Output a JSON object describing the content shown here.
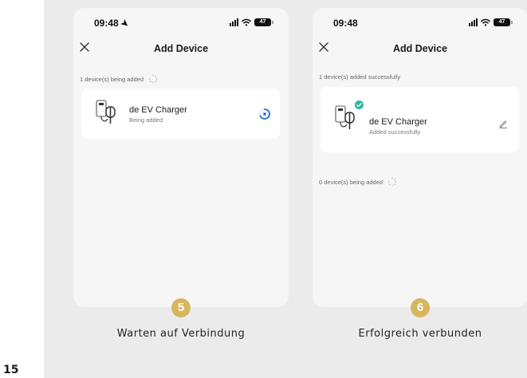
{
  "page_number": "15",
  "steps": [
    {
      "number": "5",
      "caption": "Warten auf Verbindung",
      "status_bar": {
        "time": "09:48",
        "location_arrow": "➤",
        "battery": "47"
      },
      "nav_title": "Add Device",
      "adding_label": "1 device(s) being added",
      "device": {
        "name": "de EV Charger",
        "status": "Being added"
      }
    },
    {
      "number": "6",
      "caption": "Erfolgreich verbunden",
      "status_bar": {
        "time": "09:48",
        "battery": "47"
      },
      "nav_title": "Add Device",
      "success_label": "1 device(s) added successfully",
      "device": {
        "name": "de EV Charger",
        "status": "Added successfully"
      },
      "adding_label": "0 device(s) being added"
    }
  ],
  "icons": {
    "close": "close-icon",
    "location": "location-arrow-icon",
    "signal": "cellular-signal-icon",
    "wifi": "wifi-icon",
    "battery": "battery-icon",
    "spinner": "loading-spinner-icon",
    "charger": "ev-charger-icon",
    "progress": "progress-ring-icon",
    "check": "check-badge-icon",
    "edit": "pencil-icon"
  },
  "colors": {
    "step_badge": "#d6b75d",
    "success": "#2db79d",
    "progress": "#1f6fd6",
    "panel_bg": "#ebebeb",
    "card_bg": "#ffffff"
  }
}
